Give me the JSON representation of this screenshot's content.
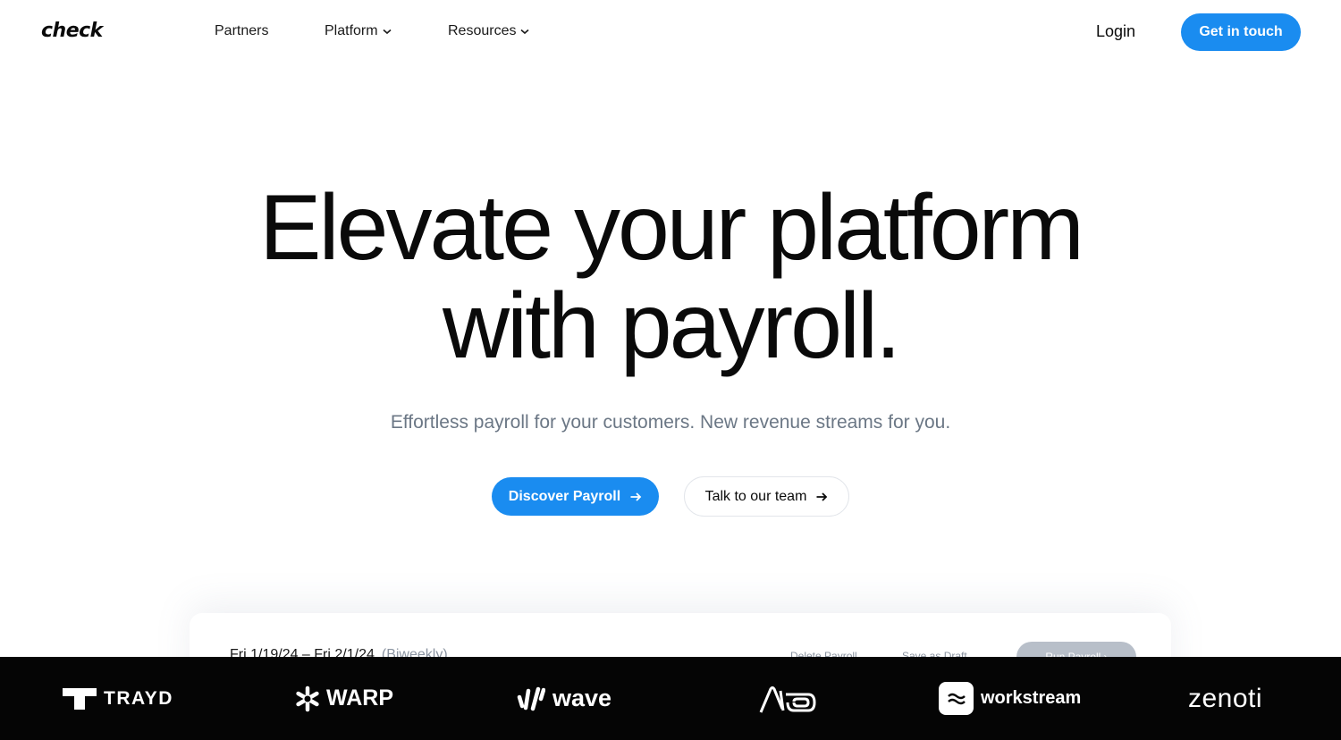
{
  "nav": {
    "logo": "check",
    "links": [
      {
        "label": "Partners"
      },
      {
        "label": "Platform"
      },
      {
        "label": "Resources"
      }
    ],
    "login": "Login",
    "cta": "Get in touch"
  },
  "hero": {
    "title_line1": "Elevate your platform",
    "title_line2": "with payroll.",
    "subtitle": "Effortless payroll for your customers. New revenue streams for you.",
    "primary_button": "Discover Payroll",
    "secondary_button": "Talk to our team"
  },
  "preview": {
    "date_range": "Fri 1/19/24 – Fri 2/1/24",
    "frequency": "(Biweekly)",
    "delete": "Delete Payroll",
    "draft": "Save as Draft",
    "run": "Run Payroll ›"
  },
  "partner_logos": {
    "items": [
      "TRAYD",
      "WARP",
      "wave",
      "workstream",
      "zenoti"
    ],
    "aio_icon": "aio-logo-icon"
  },
  "colors": {
    "accent": "#1a8cf0",
    "logobar_bg": "#050505",
    "subtitle": "#6b7785"
  }
}
